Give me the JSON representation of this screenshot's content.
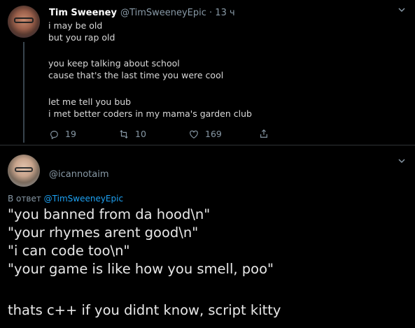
{
  "tweet": {
    "author_name": "Tim Sweeney",
    "handle_time": "@TimSweeneyEpic · 13 ч",
    "lines": [
      "i may be old",
      "but you rap old",
      "you keep talking about school",
      "cause that's the last time you were cool",
      "let me tell you bub",
      "i met better coders in my mama's garden club"
    ],
    "replies": "19",
    "retweets": "10",
    "likes": "169"
  },
  "reply": {
    "handle": "@icannotaim",
    "reply_prefix": "В ответ",
    "reply_target": "@TimSweeneyEpic",
    "lines": [
      "\"you banned from da hood\\n\"",
      "\"your rhymes arent good\\n\"",
      "\"i can code too\\n\"",
      "\"your game is like how you smell, poo\"",
      "thats c++ if you didnt know, script kitty"
    ]
  },
  "icons": [
    "reply-icon",
    "retweet-icon",
    "like-icon",
    "share-icon",
    "chevron-down-icon"
  ],
  "colors": {
    "background": "#000000",
    "link": "#1da1f2",
    "muted": "#8899a6"
  }
}
